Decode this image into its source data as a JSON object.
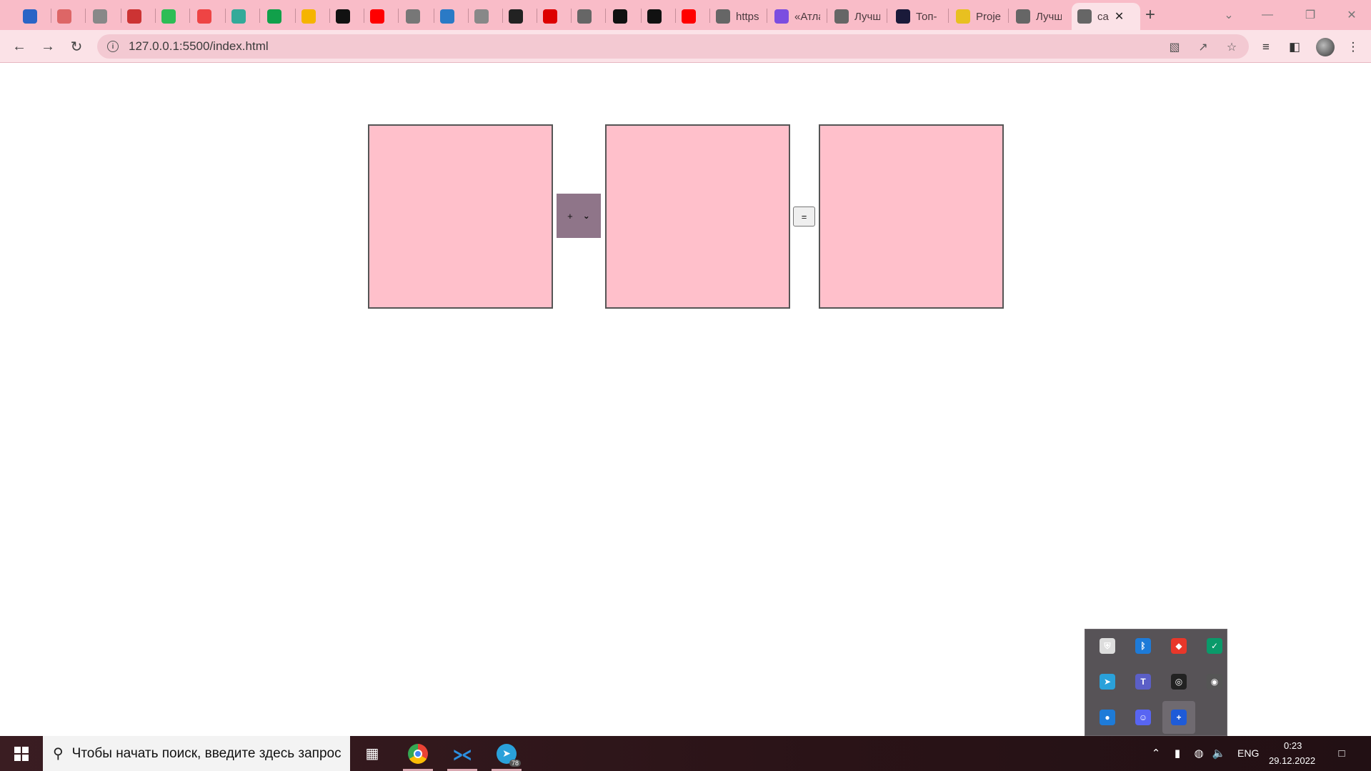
{
  "browser": {
    "tabs": [
      {
        "title": "",
        "icon": "bookmark-p-icon",
        "color": "#2a64c6"
      },
      {
        "title": "",
        "icon": "wave-icon",
        "color": "#d66"
      },
      {
        "title": "",
        "icon": "face-icon",
        "color": "#888"
      },
      {
        "title": "",
        "icon": "flower-icon",
        "color": "#c33"
      },
      {
        "title": "",
        "icon": "ed-icon",
        "color": "#2dbd55"
      },
      {
        "title": "",
        "icon": "red-circle-icon",
        "color": "#e44"
      },
      {
        "title": "",
        "icon": "tree-icon",
        "color": "#3a9"
      },
      {
        "title": "",
        "icon": "plus-green-icon",
        "color": "#11a04a"
      },
      {
        "title": "",
        "icon": "drive-icon",
        "color": "#f5b400"
      },
      {
        "title": "",
        "icon": "github-icon",
        "color": "#111"
      },
      {
        "title": "",
        "icon": "youtube-icon",
        "color": "#f00"
      },
      {
        "title": "",
        "icon": "bot-icon",
        "color": "#777"
      },
      {
        "title": "",
        "icon": "book-blue-icon",
        "color": "#2a7ac6"
      },
      {
        "title": "",
        "icon": "book-open-icon",
        "color": "#888"
      },
      {
        "title": "",
        "icon": "c-bracket-icon",
        "color": "#222"
      },
      {
        "title": "",
        "icon": "netflix-icon",
        "color": "#d00"
      },
      {
        "title": "",
        "icon": "globe-icon",
        "color": "#666"
      },
      {
        "title": "",
        "icon": "github-icon",
        "color": "#111"
      },
      {
        "title": "",
        "icon": "m-icon",
        "color": "#111"
      },
      {
        "title": "",
        "icon": "youtube-icon",
        "color": "#f00"
      },
      {
        "title": "https",
        "icon": "globe-icon",
        "color": "#666"
      },
      {
        "title": "«Атла",
        "icon": "t-icon",
        "color": "#7b4de0"
      },
      {
        "title": "Лучш",
        "icon": "globe-icon",
        "color": "#666"
      },
      {
        "title": "Топ-",
        "icon": "fe-icon",
        "color": "#1a1a3a"
      },
      {
        "title": "Proje",
        "icon": "star-yellow-icon",
        "color": "#e8c020"
      },
      {
        "title": "Лучш",
        "icon": "globe-icon",
        "color": "#666"
      },
      {
        "title": "ca",
        "icon": "globe-icon",
        "color": "#666",
        "active": true
      }
    ],
    "new_tab_label": "+",
    "url": "127.0.0.1:5500/index.html"
  },
  "page": {
    "operator_value": "+",
    "equals_label": "="
  },
  "taskbar": {
    "search_placeholder": "Чтобы начать поиск, введите здесь запрос",
    "language": "ENG",
    "time": "0:23",
    "date": "29.12.2022",
    "telegram_badge": "78"
  },
  "tray_popup": {
    "icons": [
      "shield-icon",
      "bluetooth-icon",
      "anydesk-icon",
      "vpn-shield-icon",
      "telegram-icon",
      "teams-icon",
      "nvidia-icon",
      "camera-icon",
      "pin-icon",
      "discord-icon",
      "plus-icon"
    ]
  }
}
